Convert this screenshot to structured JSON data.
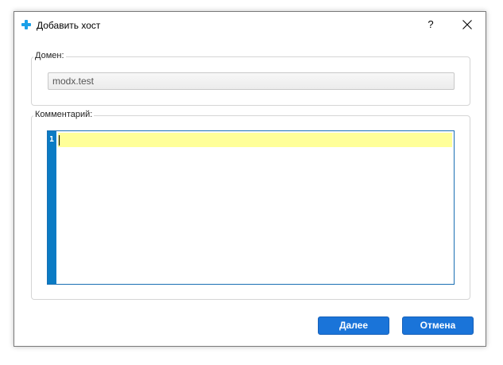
{
  "window": {
    "title": "Добавить хост",
    "help_label": "?"
  },
  "domain": {
    "label": "Домен:",
    "value": "modx.test"
  },
  "comment": {
    "label": "Комментарий:",
    "line_number": "1",
    "value": ""
  },
  "buttons": {
    "next": "Далее",
    "cancel": "Отмена"
  },
  "colors": {
    "accent": "#1a74d9",
    "gutter": "#0a7bc4",
    "current_line": "#ffff99"
  }
}
